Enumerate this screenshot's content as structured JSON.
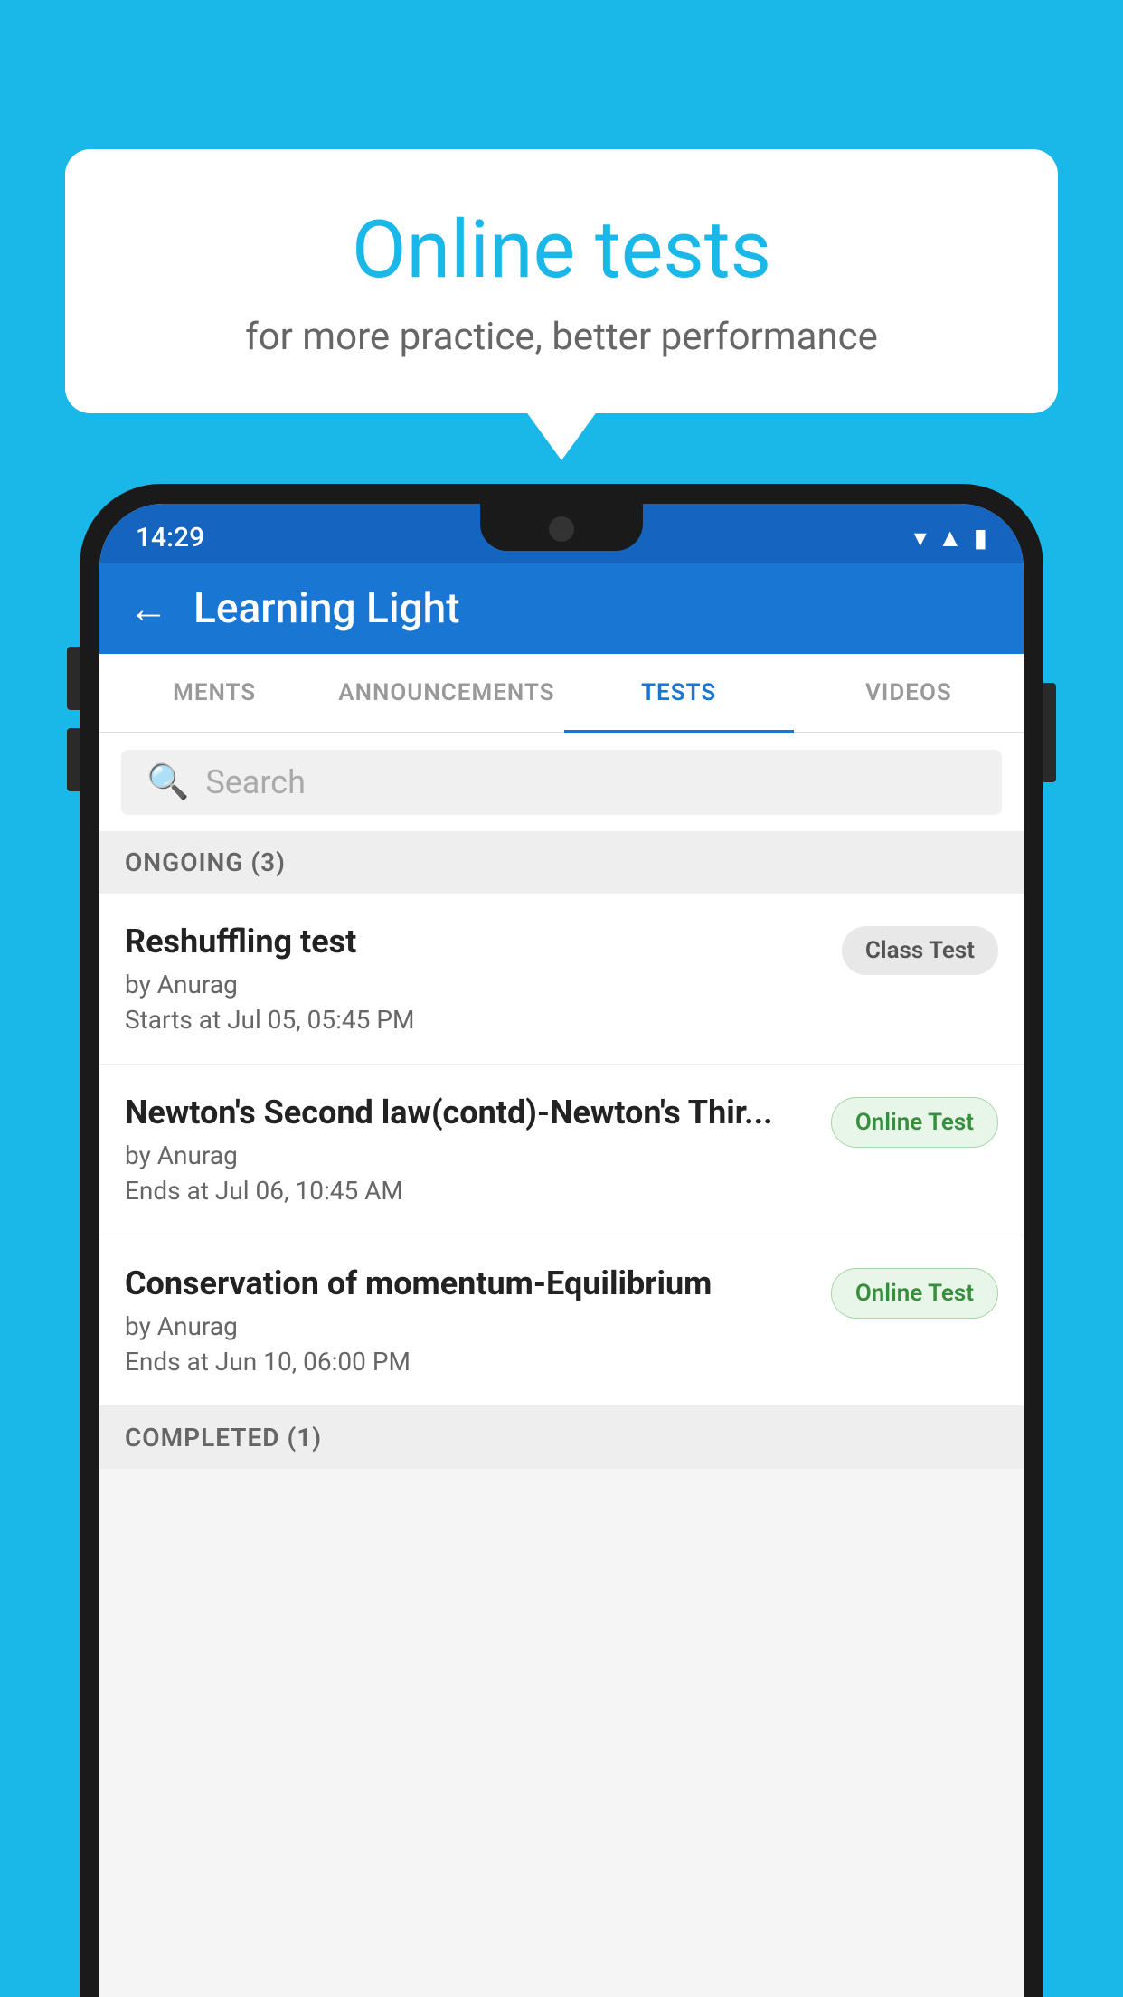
{
  "background": {
    "color": "#1ab8e8"
  },
  "speech_bubble": {
    "title": "Online tests",
    "subtitle": "for more practice, better performance"
  },
  "status_bar": {
    "time": "14:29",
    "icons": [
      "wifi",
      "signal",
      "battery"
    ]
  },
  "app_header": {
    "back_label": "←",
    "title": "Learning Light"
  },
  "tabs": {
    "items": [
      {
        "label": "MENTS",
        "active": false
      },
      {
        "label": "ANNOUNCEMENTS",
        "active": false
      },
      {
        "label": "TESTS",
        "active": true
      },
      {
        "label": "VIDEOS",
        "active": false
      }
    ]
  },
  "search": {
    "placeholder": "Search"
  },
  "ongoing_section": {
    "label": "ONGOING (3)"
  },
  "tests": [
    {
      "name": "Reshuffling test",
      "author": "by Anurag",
      "time_label": "Starts at",
      "time_value": "Jul 05, 05:45 PM",
      "badge": "Class Test",
      "badge_type": "class"
    },
    {
      "name": "Newton's Second law(contd)-Newton's Thir...",
      "author": "by Anurag",
      "time_label": "Ends at",
      "time_value": "Jul 06, 10:45 AM",
      "badge": "Online Test",
      "badge_type": "online"
    },
    {
      "name": "Conservation of momentum-Equilibrium",
      "author": "by Anurag",
      "time_label": "Ends at",
      "time_value": "Jun 10, 06:00 PM",
      "badge": "Online Test",
      "badge_type": "online"
    }
  ],
  "completed_section": {
    "label": "COMPLETED (1)"
  }
}
